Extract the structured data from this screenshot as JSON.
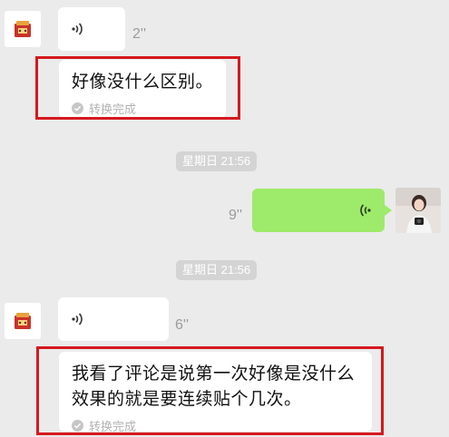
{
  "messages": [
    {
      "duration": "2''",
      "transcript": "好像没什么区别。",
      "status": "转换完成"
    },
    {
      "timestamp": "星期日 21:56",
      "outgoing_duration": "9''"
    },
    {
      "timestamp": "星期日 21:56"
    },
    {
      "duration": "6''",
      "transcript_line1": "我看了评论是说第一次好像是没什么",
      "transcript_line2": "效果的就是要连续贴个几次。",
      "status": "转换完成"
    }
  ],
  "icons": {
    "sender_avatar": "red-box-avatar-icon",
    "voice_incoming": "voice-wave-icon",
    "voice_outgoing": "voice-wave-icon",
    "check": "check-circle-icon",
    "own_avatar": "photo-avatar"
  },
  "colors": {
    "background": "#ebebeb",
    "incoming_bubble": "#ffffff",
    "outgoing_bubble": "#9eea6a",
    "highlight_frame": "#d5191e",
    "timestamp_pill": "#d4d4d4"
  }
}
